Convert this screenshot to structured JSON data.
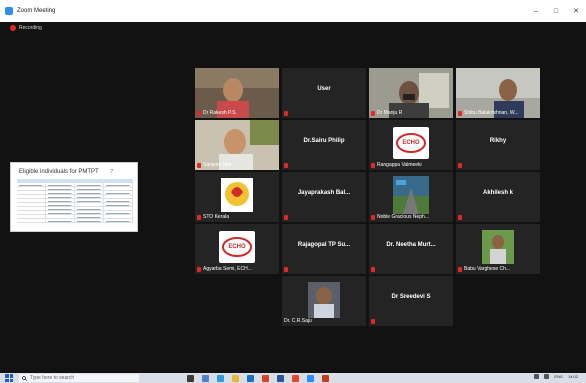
{
  "window": {
    "title": "Zoom Meeting",
    "controls": [
      "–",
      "□",
      "✕"
    ]
  },
  "recording": {
    "label": "Recording"
  },
  "shared_doc": {
    "title": "Eligible individuals for PMTPT",
    "marker": "?"
  },
  "participants": {
    "rakesh": "Dr Rakesh P.S.",
    "user": "User",
    "manju": "Dr Manju R",
    "shibu": "Shibu Balakrishnan, W...",
    "sanjeev": "Sanjeev Nair",
    "sairu": "Dr.Sairu Philip",
    "rangappa": "Rangappa Valmeeki",
    "rikhy": "Rikhy",
    "sto": "STO Kerala",
    "jayaprakash": "Jayaprakash  Bal...",
    "noble": "Noble Gracious Neph...",
    "akhilesh": "Akhilesh k",
    "agyarba": "Agyarba Semi, ECH...",
    "rajagopal": "Rajagopal TP Su...",
    "neetha": "Dr. Neetha  Murt...",
    "babu": "Babu Varghese Ch...",
    "saju": "Dr. C.R.Saju",
    "sreedevi": "Dr Sreedevi S"
  },
  "logos": {
    "echo": "ECHO"
  },
  "taskbar": {
    "search_placeholder": "Type here to search",
    "time": "14:02",
    "date": "ENG"
  },
  "colors": {
    "accent": "#2d8cff",
    "active_speaker": "#d8e24a",
    "mic_muted": "#e02828"
  }
}
